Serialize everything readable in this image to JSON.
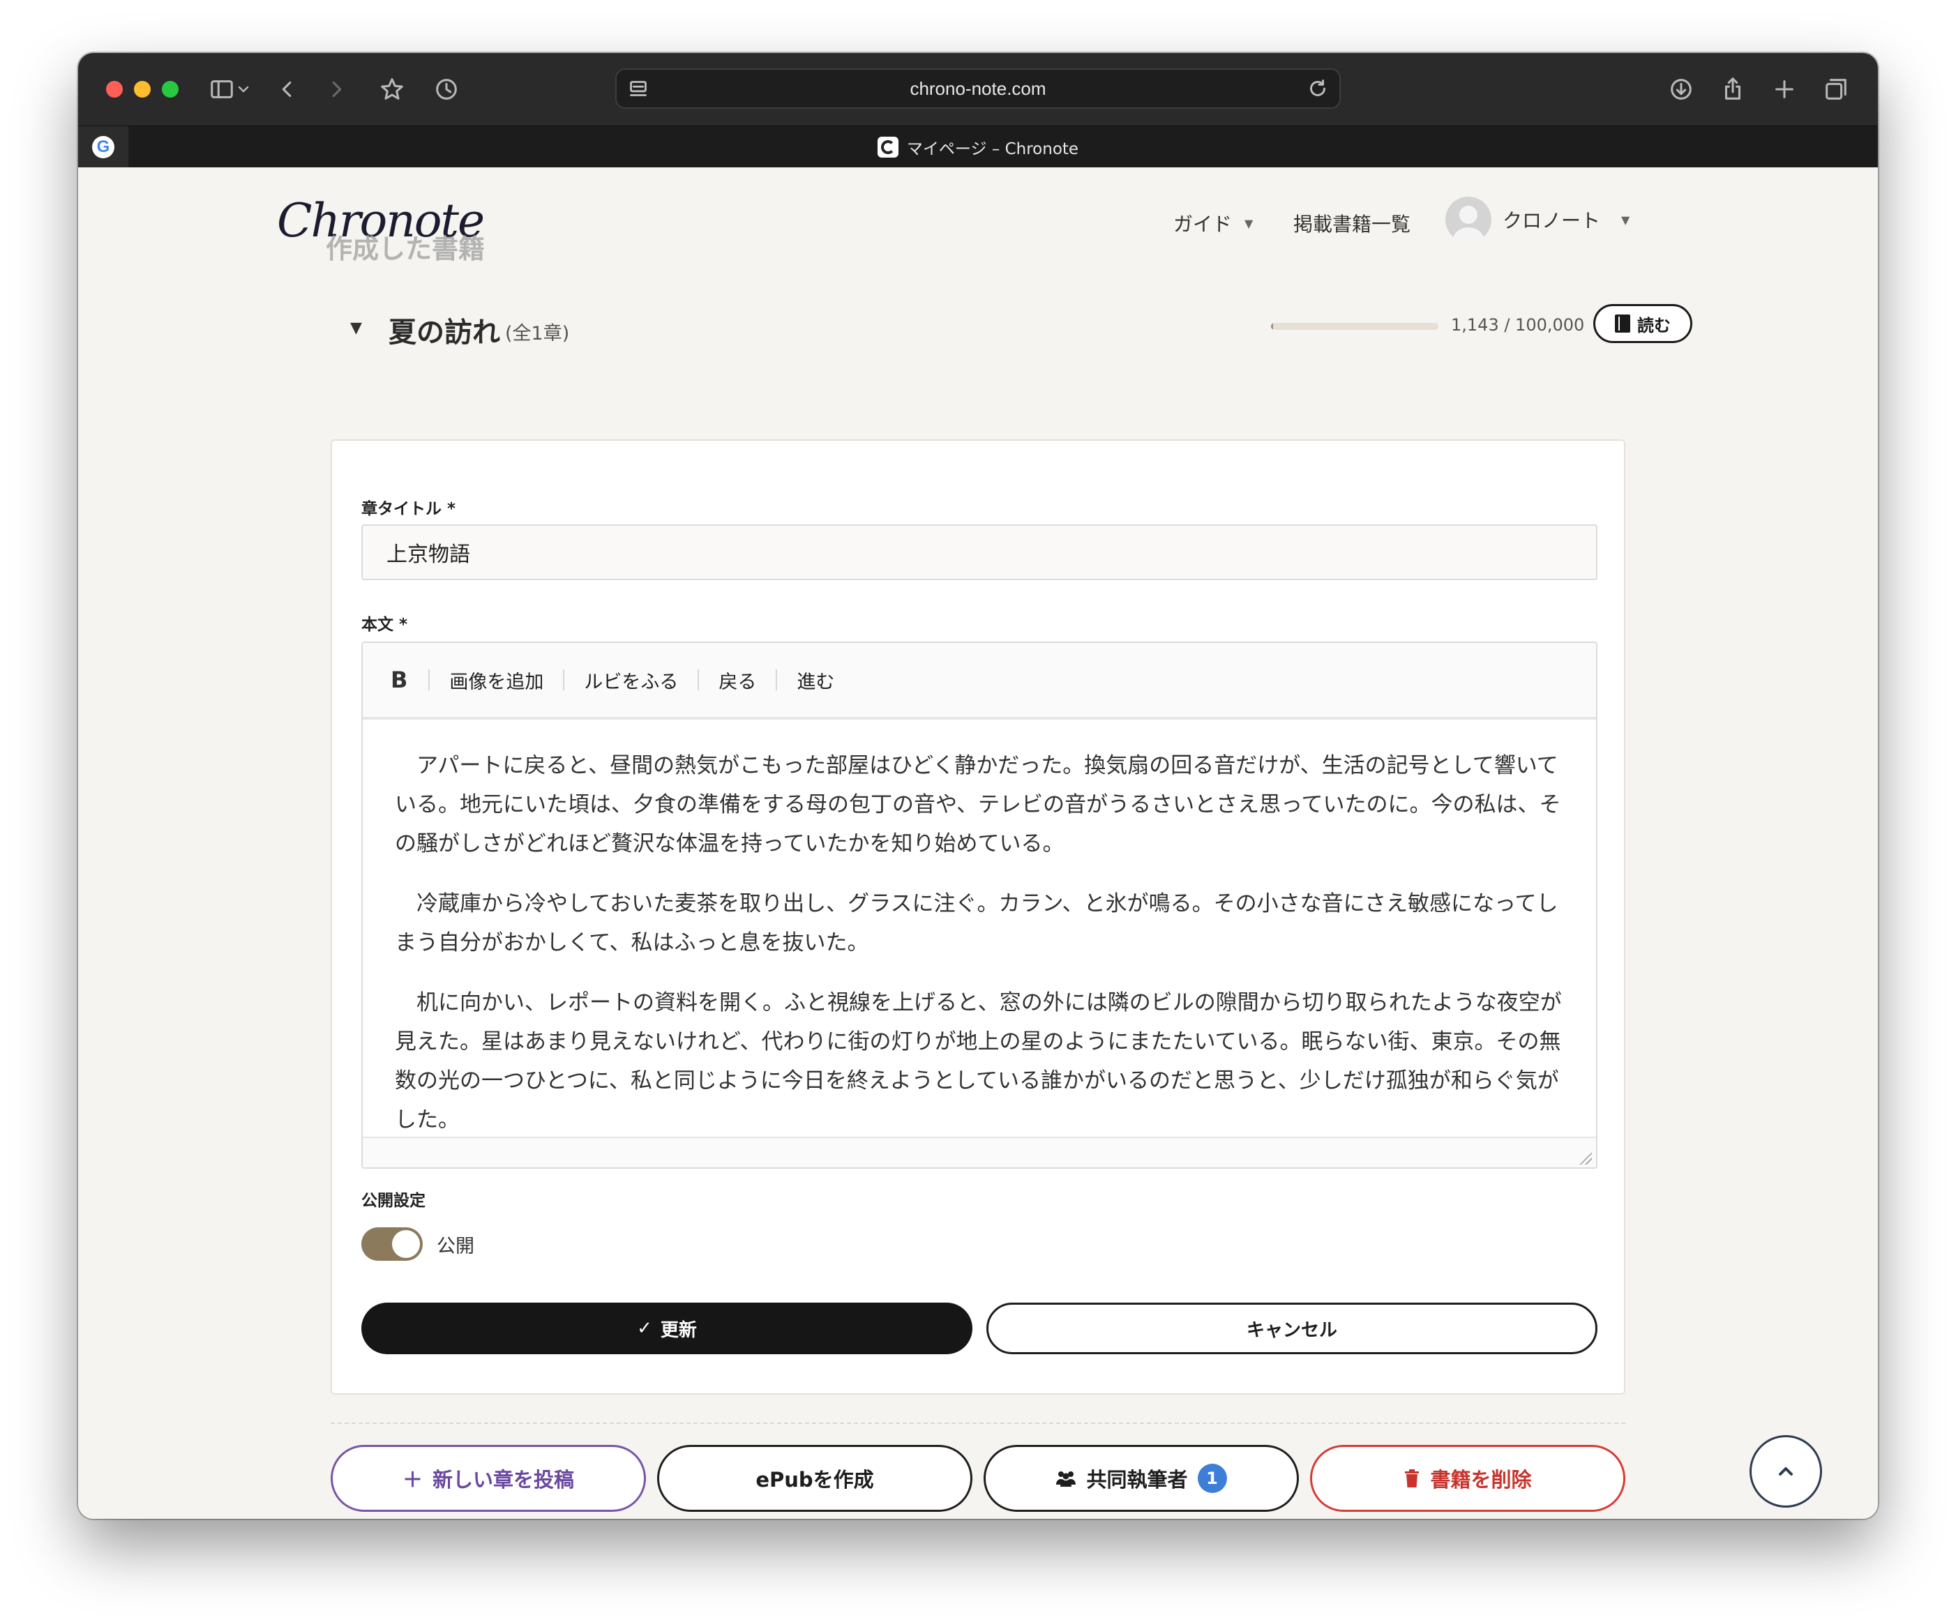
{
  "browser": {
    "url": "chrono-note.com",
    "tab_title": "マイページ – Chronote"
  },
  "header": {
    "logo": "Chronote",
    "subtitle": "作成した書籍",
    "nav": {
      "guide": "ガイド",
      "books": "掲載書籍一覧",
      "user": "クロノート"
    }
  },
  "book": {
    "title": "夏の訪れ",
    "chapter_count": "(全1章)",
    "progress_text": "1,143 / 100,000",
    "progress_fraction": 0.01143,
    "read_label": "読む"
  },
  "form": {
    "chapter_title_label": "章タイトル *",
    "chapter_title_value": "上京物語",
    "body_label": "本文 *",
    "toolbar": {
      "bold": "B",
      "add_image": "画像を追加",
      "ruby": "ルビをふる",
      "undo": "戻る",
      "redo": "進む"
    },
    "body_paragraphs": [
      "アパートに戻ると、昼間の熱気がこもった部屋はひどく静かだった。換気扇の回る音だけが、生活の記号として響いている。地元にいた頃は、夕食の準備をする母の包丁の音や、テレビの音がうるさいとさえ思っていたのに。今の私は、その騒がしさがどれほど贅沢な体温を持っていたかを知り始めている。",
      "冷蔵庫から冷やしておいた麦茶を取り出し、グラスに注ぐ。カラン、と氷が鳴る。その小さな音にさえ敏感になってしまう自分がおかしくて、私はふっと息を抜いた。",
      "机に向かい、レポートの資料を開く。ふと視線を上げると、窓の外には隣のビルの隙間から切り取られたような夜空が見えた。星はあまり見えないけれど、代わりに街の灯りが地上の星のようにまたたいている。眠らない街、東京。その無数の光の一つひとつに、私と同じように今日を終えようとしている誰かがいるのだと思うと、少しだけ孤独が和らぐ気がした。"
    ],
    "visibility_label": "公開設定",
    "visibility_value": "公開",
    "visibility_on": true,
    "update_label": "更新",
    "cancel_label": "キャンセル"
  },
  "actions": {
    "new_chapter": "新しい章を投稿",
    "epub": "ePubを作成",
    "coauthors": "共同執筆者",
    "coauthors_count": "1",
    "delete": "書籍を削除"
  },
  "colors": {
    "accent_purple": "#6a48a0",
    "danger_red": "#c8342d",
    "toggle_brown": "#8b7a5c",
    "badge_blue": "#3d7fd8"
  }
}
